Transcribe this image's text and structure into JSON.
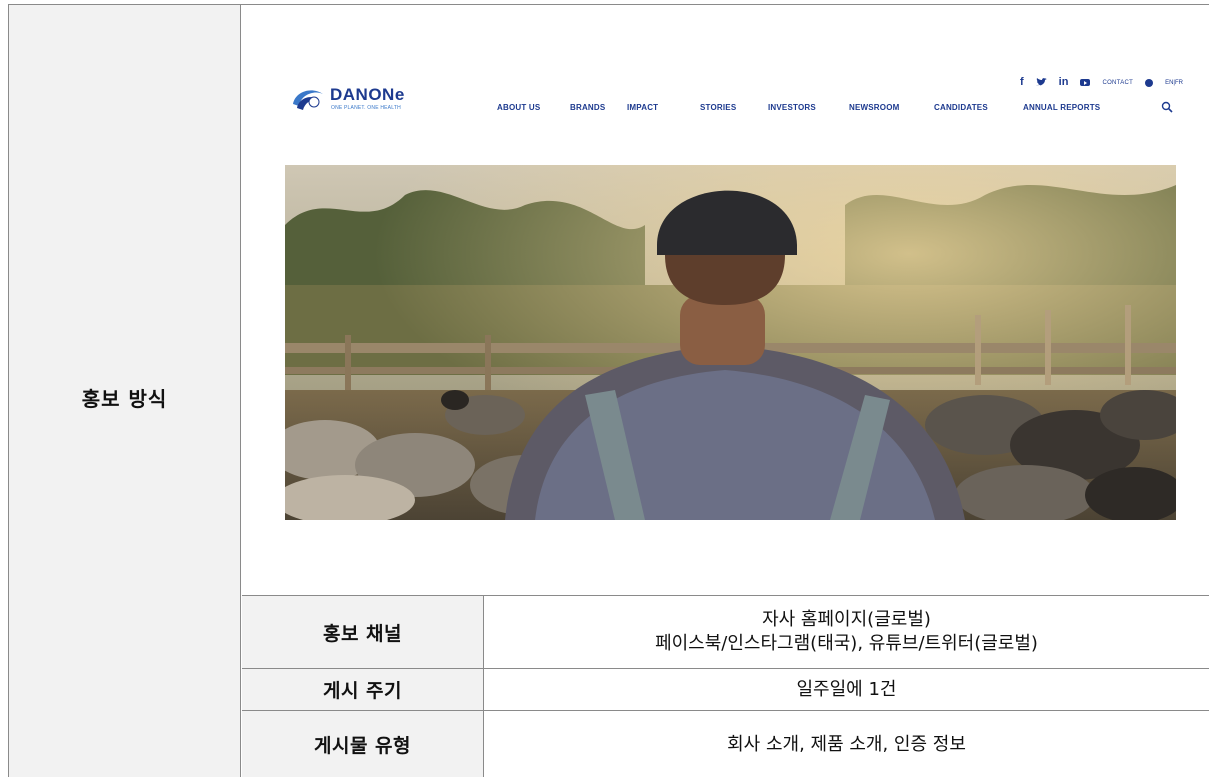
{
  "left_label": "홍보 방식",
  "site": {
    "logo_text": "DANONe",
    "logo_tagline": "ONE PLANET. ONE HEALTH",
    "social": {
      "facebook": "f",
      "twitter": "🐦",
      "linkedin": "in",
      "youtube": "youtube-icon",
      "contact": "CONTACT",
      "lang": "EN|FR"
    },
    "nav": [
      "ABOUT US",
      "BRANDS",
      "IMPACT",
      "STORIES",
      "INVESTORS",
      "NEWSROOM",
      "CANDIDATES",
      "ANNUAL REPORTS"
    ],
    "hero_alt": "farmer-with-sheep-photo"
  },
  "colors": {
    "brand_blue": "#1d3a8f",
    "label_bg": "#f2f2f2",
    "border": "#8a8a8a"
  },
  "table": {
    "channel_label": "홍보 채널",
    "channel_line1": "자사 홈페이지(글로벌)",
    "channel_line2": "페이스북/인스타그램(태국), 유튜브/트위터(글로벌)",
    "cycle_label": "게시 주기",
    "cycle_value": "일주일에 1건",
    "type_label": "게시물 유형",
    "type_value": "회사 소개, 제품 소개, 인증 정보"
  }
}
